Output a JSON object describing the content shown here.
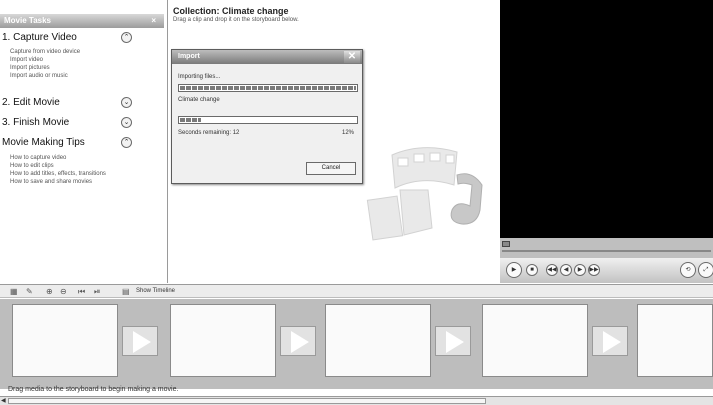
{
  "task_pane": {
    "header": "Movie Tasks",
    "close": "×",
    "sections": [
      {
        "title": "1. Capture Video",
        "chevron": "⌃",
        "links": [
          "Capture from video device",
          "Import video",
          "Import pictures",
          "Import audio or music"
        ]
      },
      {
        "title": "2. Edit Movie",
        "chevron": "⌄",
        "links": []
      },
      {
        "title": "3. Finish Movie",
        "chevron": "⌄",
        "links": []
      },
      {
        "title": "Movie Making Tips",
        "chevron": "⌃",
        "links": [
          "How to capture video",
          "How to edit clips",
          "How to add titles, effects, transitions",
          "How to save and share movies"
        ]
      }
    ]
  },
  "collection": {
    "title": "Collection: Climate change",
    "subtitle": "Drag a clip and drop it on the storyboard below."
  },
  "import_dialog": {
    "title": "Import",
    "close": "✕",
    "status": "Importing files...",
    "file_name": "Climate change",
    "progress_text": "Seconds remaining: 12",
    "percent": "12%",
    "file_progress": 1.0,
    "total_progress": 0.12,
    "cancel_label": "Cancel"
  },
  "monitor": {
    "controls": [
      "▶",
      "■",
      "◀◀",
      "◀",
      "▶",
      "▶▶",
      "⟲",
      "⤢"
    ]
  },
  "storyboard": {
    "toolbar_label": "Show Timeline",
    "status": "Drag media to the storyboard to begin making a movie.",
    "frame_count": 5
  },
  "colors": {
    "monitor_screen": "#000000",
    "storyboard_bg": "#bdbdbd",
    "task_header": "#9c9c9c"
  }
}
